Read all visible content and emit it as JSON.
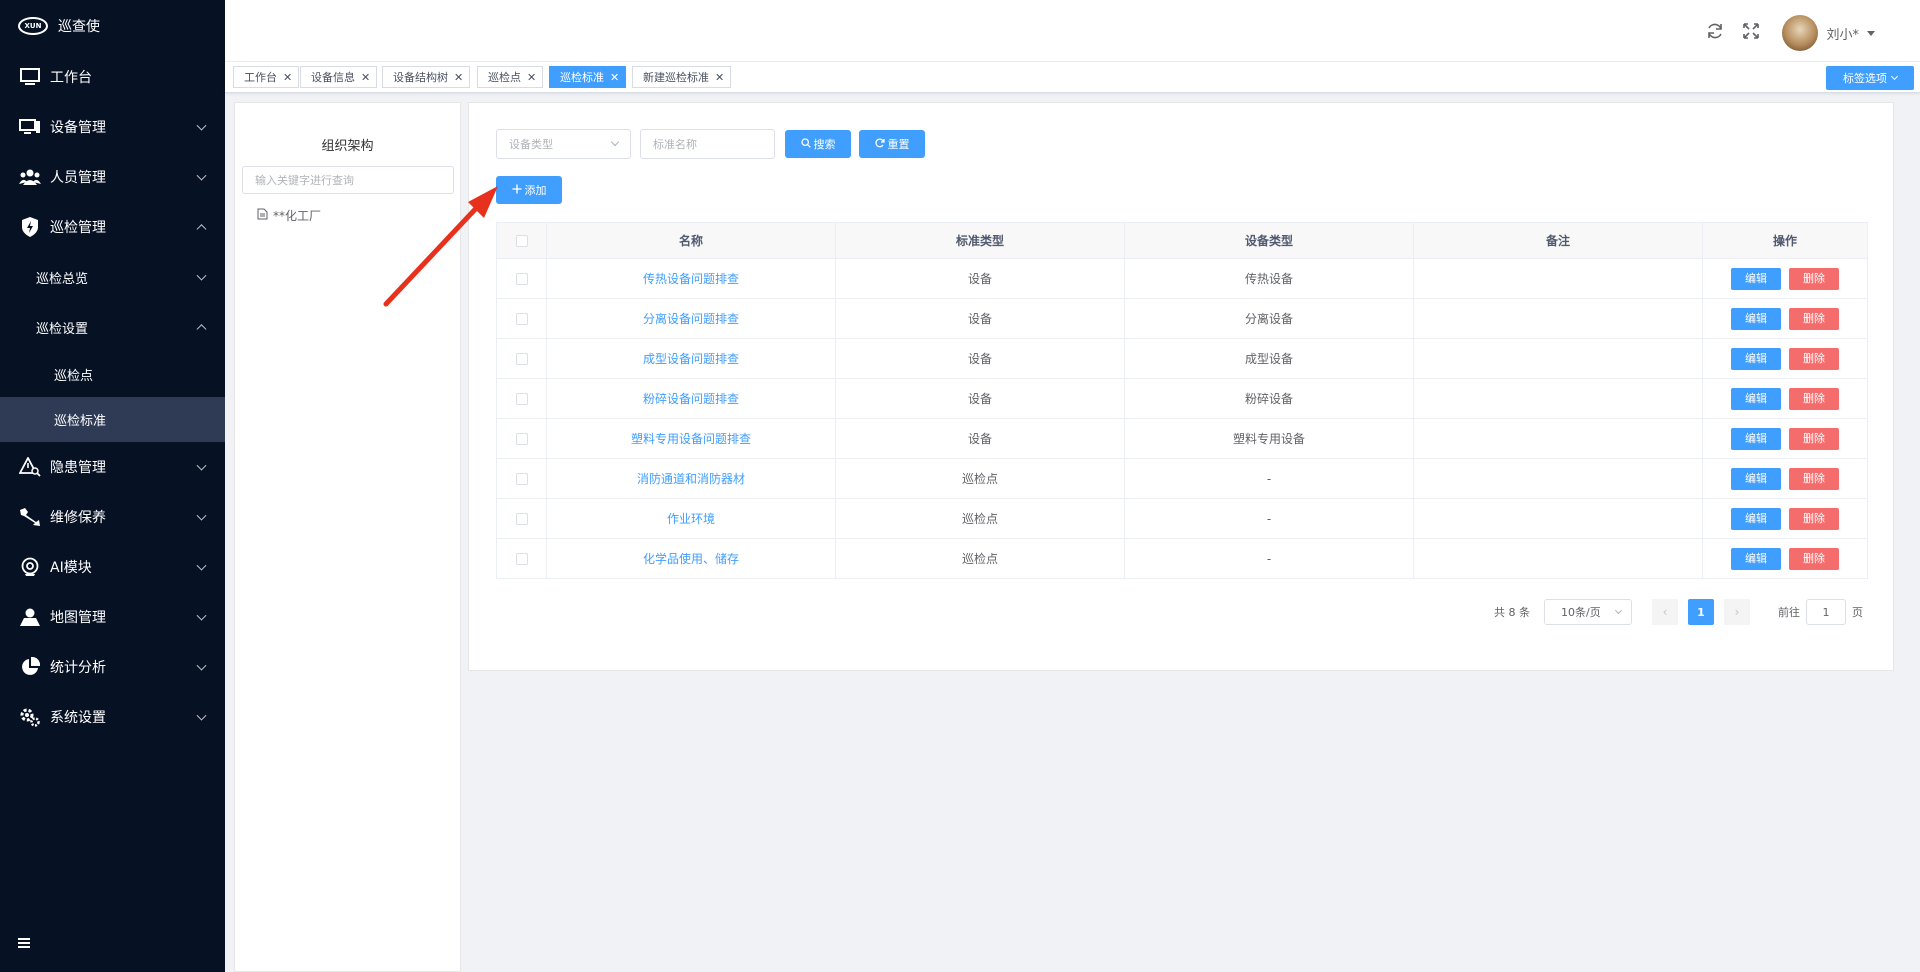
{
  "app": {
    "name": "巡查使",
    "logo_text": "XUN"
  },
  "sidebar": {
    "items": [
      {
        "label": "工作台",
        "icon": "monitor-icon",
        "arrow": ""
      },
      {
        "label": "设备管理",
        "icon": "desktop-icon",
        "arrow": "down"
      },
      {
        "label": "人员管理",
        "icon": "people-icon",
        "arrow": "down"
      },
      {
        "label": "巡检管理",
        "icon": "shield-bolt-icon",
        "arrow": "up"
      },
      {
        "label": "巡检总览",
        "arrow": "down"
      },
      {
        "label": "巡检设置",
        "arrow": "up"
      },
      {
        "label": "巡检点"
      },
      {
        "label": "巡检标准",
        "active": true
      },
      {
        "label": "隐患管理",
        "icon": "warning-search-icon",
        "arrow": "down"
      },
      {
        "label": "维修保养",
        "icon": "wrench-icon",
        "arrow": "down"
      },
      {
        "label": "AI模块",
        "icon": "camera-icon",
        "arrow": "down"
      },
      {
        "label": "地图管理",
        "icon": "map-user-icon",
        "arrow": "down"
      },
      {
        "label": "统计分析",
        "icon": "pie-chart-icon",
        "arrow": "down"
      },
      {
        "label": "系统设置",
        "icon": "gears-icon",
        "arrow": "down"
      }
    ]
  },
  "header": {
    "user_name": "刘小*",
    "icons": [
      "refresh-icon",
      "fullscreen-icon"
    ]
  },
  "tags": {
    "items": [
      {
        "label": "工作台",
        "active": false
      },
      {
        "label": "设备信息",
        "active": false
      },
      {
        "label": "设备结构树",
        "active": false
      },
      {
        "label": "巡检点",
        "active": false
      },
      {
        "label": "巡检标准",
        "active": true
      },
      {
        "label": "新建巡检标准",
        "active": false
      }
    ],
    "options_label": "标签选项"
  },
  "tree": {
    "title": "组织架构",
    "search_placeholder": "输入关键字进行查询",
    "node": "**化工厂"
  },
  "filters": {
    "device_type_placeholder": "设备类型",
    "standard_name_placeholder": "标准名称",
    "search_label": "搜索",
    "reset_label": "重置",
    "add_label": "添加"
  },
  "table": {
    "columns": [
      "名称",
      "标准类型",
      "设备类型",
      "备注",
      "操作"
    ],
    "edit_label": "编辑",
    "delete_label": "删除",
    "rows": [
      {
        "name": "传热设备问题排查",
        "standard_type": "设备",
        "device_type": "传热设备",
        "remark": ""
      },
      {
        "name": "分离设备问题排查",
        "standard_type": "设备",
        "device_type": "分离设备",
        "remark": ""
      },
      {
        "name": "成型设备问题排查",
        "standard_type": "设备",
        "device_type": "成型设备",
        "remark": ""
      },
      {
        "name": "粉碎设备问题排查",
        "standard_type": "设备",
        "device_type": "粉碎设备",
        "remark": ""
      },
      {
        "name": "塑料专用设备问题排查",
        "standard_type": "设备",
        "device_type": "塑料专用设备",
        "remark": ""
      },
      {
        "name": "消防通道和消防器材",
        "standard_type": "巡检点",
        "device_type": "-",
        "remark": ""
      },
      {
        "name": "作业环境",
        "standard_type": "巡检点",
        "device_type": "-",
        "remark": ""
      },
      {
        "name": "化学品使用、储存",
        "standard_type": "巡检点",
        "device_type": "-",
        "remark": ""
      }
    ]
  },
  "pagination": {
    "total_text": "共 8 条",
    "page_size": "10条/页",
    "current_page": "1",
    "goto_prefix": "前往",
    "goto_value": "1",
    "goto_suffix": "页"
  },
  "colors": {
    "sidebar_bg": "#071124",
    "primary": "#409eff",
    "danger": "#f56c6c",
    "annotation_arrow": "#e8311c"
  }
}
